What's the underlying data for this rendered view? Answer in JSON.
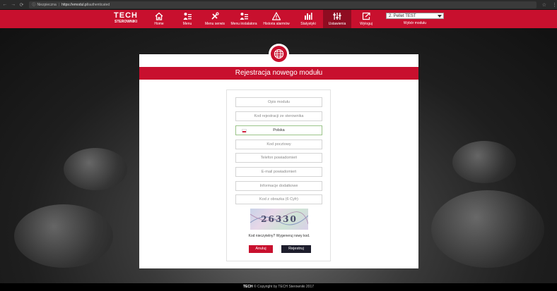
{
  "browser": {
    "security_label": "Niezpieczna",
    "url_host": "https://emodul.pl",
    "url_path": "/authenticated"
  },
  "header": {
    "logo_big": "TECH",
    "logo_small": "STEROWNIKI",
    "nav": [
      {
        "label": "Home",
        "icon": "home-icon"
      },
      {
        "label": "Menu",
        "icon": "menu-icon"
      },
      {
        "label": "Menu serwis",
        "icon": "tools-icon"
      },
      {
        "label": "Menu instalatora",
        "icon": "installer-icon"
      },
      {
        "label": "Historia alarmów",
        "icon": "alarm-icon"
      },
      {
        "label": "Statystyki",
        "icon": "stats-icon"
      },
      {
        "label": "Ustawienia",
        "icon": "settings-icon",
        "active": true
      },
      {
        "label": "Wyloguj",
        "icon": "logout-icon"
      }
    ],
    "module_select": "2. Pellet TEST",
    "module_label": "Wybór modułu"
  },
  "card": {
    "title": "Rejestracja nowego modułu",
    "fields": {
      "description": "Opis modułu",
      "reg_code": "Kod rejestracji ze sterownika",
      "language": "Polska",
      "postal_code": "Kod pocztowy",
      "notify_phone": "Telefon powiadomień",
      "notify_email": "E-mail powiadomień",
      "extra_info": "Informacje dodatkowe",
      "captcha_code": "Kod z obrazka (6 Cyfr)"
    },
    "captcha_text": "26330",
    "captcha_hint": "Kod nieczytelny? Wygeneruj nowy kod.",
    "cancel_label": "Anuluj",
    "register_label": "Rejestruj"
  },
  "footer": {
    "logo": "TECH",
    "text": "© Copyright by TECH Sterowniki 2017"
  },
  "colors": {
    "brand_red": "#c8102e",
    "active_nav": "#8f0c21",
    "dark_button": "#1d1d2c"
  }
}
